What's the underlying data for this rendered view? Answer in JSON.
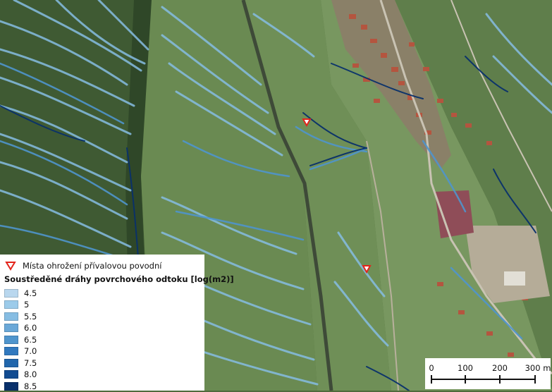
{
  "legend": {
    "hazard_label": "Místa ohrožení přívalovou povodní",
    "flow_title": "Soustředěné dráhy povrchového odtoku [log(m2)]",
    "classes": [
      {
        "label": "4.5",
        "color": "#b9d7ee"
      },
      {
        "label": "5",
        "color": "#9ccbea"
      },
      {
        "label": "5.5",
        "color": "#86bde3"
      },
      {
        "label": "6.0",
        "color": "#6aa8d8"
      },
      {
        "label": "6.5",
        "color": "#4f95cd"
      },
      {
        "label": "7.0",
        "color": "#3179bf"
      },
      {
        "label": "7.5",
        "color": "#2166ac"
      },
      {
        "label": "8.0",
        "color": "#114b91"
      },
      {
        "label": "8.5",
        "color": "#08306b"
      }
    ]
  },
  "scale": {
    "labels": [
      "0",
      "100",
      "200",
      "300 m"
    ]
  },
  "colors": {
    "hazard_marker": "#e3241b",
    "vegetation": "#4e6a3c",
    "rooftops": "#b4553f"
  }
}
